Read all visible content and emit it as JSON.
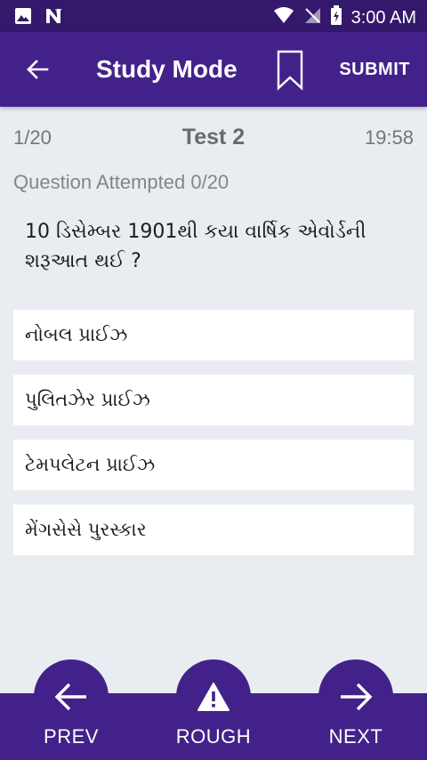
{
  "status_bar": {
    "time": "3:00 AM"
  },
  "app_bar": {
    "title": "Study Mode",
    "submit_label": "SUBMIT"
  },
  "info": {
    "counter": "1/20",
    "test_name": "Test 2",
    "timer": "19:58"
  },
  "attempted": "Question Attempted 0/20",
  "question": "10 ડિસેમ્બર 1901થી કયા વાર્ષિક એવોર્ડની શરૂઆત થઈ ?",
  "options": [
    "નોબલ પ્રાઈઝ",
    "પુલિતઝેર પ્રાઈઝ",
    "ટેમપલેટન પ્રાઈઝ",
    "મેંગસેસે પુરસ્કાર"
  ],
  "nav": {
    "prev_label": "PREV",
    "rough_label": "ROUGH",
    "next_label": "NEXT"
  },
  "colors": {
    "status_bar": "#33186b",
    "app_bar": "#42228a",
    "background": "#e9edf1"
  }
}
